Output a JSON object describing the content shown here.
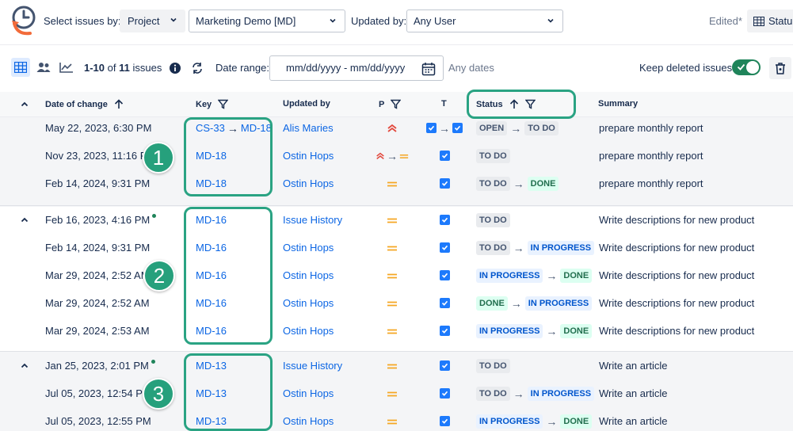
{
  "topbar": {
    "select_label": "Select issues by:",
    "project_selector": "Project",
    "project_value": "Marketing Demo [MD]",
    "updated_by_label": "Updated by:",
    "updated_by_value": "Any User",
    "edited_label": "Edited*",
    "status_button": "Statu"
  },
  "toolbar": {
    "range": "1-10",
    "of": "of",
    "total": "11",
    "issues_word": "issues",
    "date_range_label": "Date range:",
    "date_placeholder": "mm/dd/yyyy - mm/dd/yyyy",
    "any_dates": "Any dates",
    "keep_deleted_label": "Keep deleted issues",
    "keep_deleted_on": true
  },
  "columns": {
    "date": "Date of change",
    "key": "Key",
    "updated_by": "Updated by",
    "priority": "P",
    "type": "T",
    "status": "Status",
    "summary": "Summary"
  },
  "groups": [
    {
      "rows": [
        {
          "date": "May 22, 2023, 6:30 PM",
          "key_from": "CS-33",
          "key": "MD-18",
          "user": "Alis Maries",
          "prio": "highest",
          "type_change": true,
          "status_from": "OPEN",
          "status_to": "TO DO",
          "summary": "prepare monthly report"
        },
        {
          "date": "Nov 23, 2023, 11:16 PM",
          "key": "MD-18",
          "user": "Ostin Hops",
          "prio": "highest-to-medium",
          "type_change": false,
          "status_from": "TO DO",
          "status_to": "",
          "summary": "prepare monthly report"
        },
        {
          "date": "Feb 14, 2024, 9:31 PM",
          "key": "MD-18",
          "user": "Ostin Hops",
          "prio": "medium",
          "type_change": false,
          "status_from": "TO DO",
          "status_to": "DONE",
          "summary": "prepare monthly report"
        }
      ]
    },
    {
      "rows": [
        {
          "date": "Feb 16, 2023, 4:16 PM",
          "key": "MD-16",
          "user": "Issue History",
          "prio": "medium",
          "type_change": false,
          "status_from": "TO DO",
          "status_to": "",
          "summary": "Write descriptions for new product"
        },
        {
          "date": "Feb 14, 2024, 9:31 PM",
          "key": "MD-16",
          "user": "Ostin Hops",
          "prio": "medium",
          "type_change": false,
          "status_from": "TO DO",
          "status_to": "IN PROGRESS",
          "summary": "Write descriptions for new product"
        },
        {
          "date": "Mar 29, 2024, 2:52 AM",
          "key": "MD-16",
          "user": "Ostin Hops",
          "prio": "medium",
          "type_change": false,
          "status_from": "IN PROGRESS",
          "status_to": "DONE",
          "summary": "Write descriptions for new product"
        },
        {
          "date": "Mar 29, 2024, 2:52 AM",
          "key": "MD-16",
          "user": "Ostin Hops",
          "prio": "medium",
          "type_change": false,
          "status_from": "DONE",
          "status_to": "IN PROGRESS",
          "summary": "Write descriptions for new product"
        },
        {
          "date": "Mar 29, 2024, 2:53 AM",
          "key": "MD-16",
          "user": "Ostin Hops",
          "prio": "medium",
          "type_change": false,
          "status_from": "IN PROGRESS",
          "status_to": "DONE",
          "summary": "Write descriptions for new product"
        }
      ]
    },
    {
      "rows": [
        {
          "date": "Jan 25, 2023, 2:01 PM",
          "key": "MD-13",
          "user": "Issue History",
          "prio": "medium",
          "type_change": false,
          "status_from": "TO DO",
          "status_to": "",
          "summary": "Write an article"
        },
        {
          "date": "Jul 05, 2023, 12:54 PM",
          "key": "MD-13",
          "user": "Ostin Hops",
          "prio": "medium",
          "type_change": false,
          "status_from": "TO DO",
          "status_to": "IN PROGRESS",
          "summary": "Write an article"
        },
        {
          "date": "Jul 05, 2023, 12:55 PM",
          "key": "MD-13",
          "user": "Ostin Hops",
          "prio": "medium",
          "type_change": false,
          "status_from": "IN PROGRESS",
          "status_to": "DONE",
          "summary": "Write an article"
        }
      ]
    }
  ],
  "annotations": [
    "1",
    "2",
    "3"
  ],
  "colors": {
    "accent": "#0c66e4",
    "annotation": "#26a07c",
    "toggle_on": "#1f845a",
    "priority_high": "#e2483d",
    "priority_medium": "#f5a623"
  }
}
